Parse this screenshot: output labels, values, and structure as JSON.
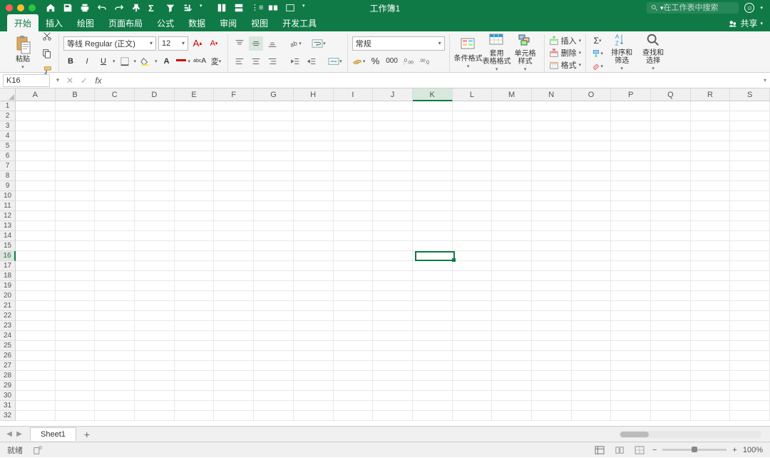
{
  "title": "工作簿1",
  "search_placeholder": "在工作表中搜索",
  "share_label": "共享",
  "menus": [
    "开始",
    "插入",
    "绘图",
    "页面布局",
    "公式",
    "数据",
    "审阅",
    "视图",
    "开发工具"
  ],
  "active_menu": 0,
  "paste_label": "粘贴",
  "font_name": "等线 Regular (正文)",
  "font_size": "12",
  "number_format": "常规",
  "cond_fmt": "条件格式",
  "table_fmt": "套用\n表格格式",
  "cell_style": "单元格\n样式",
  "insert_label": "插入",
  "delete_label": "删除",
  "format_label": "格式",
  "sort_filter": "排序和\n筛选",
  "find_select": "查找和\n选择",
  "name_box": "K16",
  "columns": [
    "A",
    "B",
    "C",
    "D",
    "E",
    "F",
    "G",
    "H",
    "I",
    "J",
    "K",
    "L",
    "M",
    "N",
    "O",
    "P",
    "Q",
    "R",
    "S"
  ],
  "rows": [
    "1",
    "2",
    "3",
    "4",
    "5",
    "6",
    "7",
    "8",
    "9",
    "10",
    "11",
    "12",
    "13",
    "14",
    "15",
    "16",
    "17",
    "18",
    "19",
    "20",
    "21",
    "22",
    "23",
    "24",
    "25",
    "26",
    "27",
    "28",
    "29",
    "30",
    "31",
    "32"
  ],
  "active_col": 10,
  "active_row": 15,
  "sheet_name": "Sheet1",
  "status": "就绪",
  "zoom": "100%",
  "colors": {
    "green": "#0f7a46",
    "traffic_red": "#ff5f57",
    "traffic_yellow": "#febc2e",
    "traffic_green": "#28c840"
  }
}
